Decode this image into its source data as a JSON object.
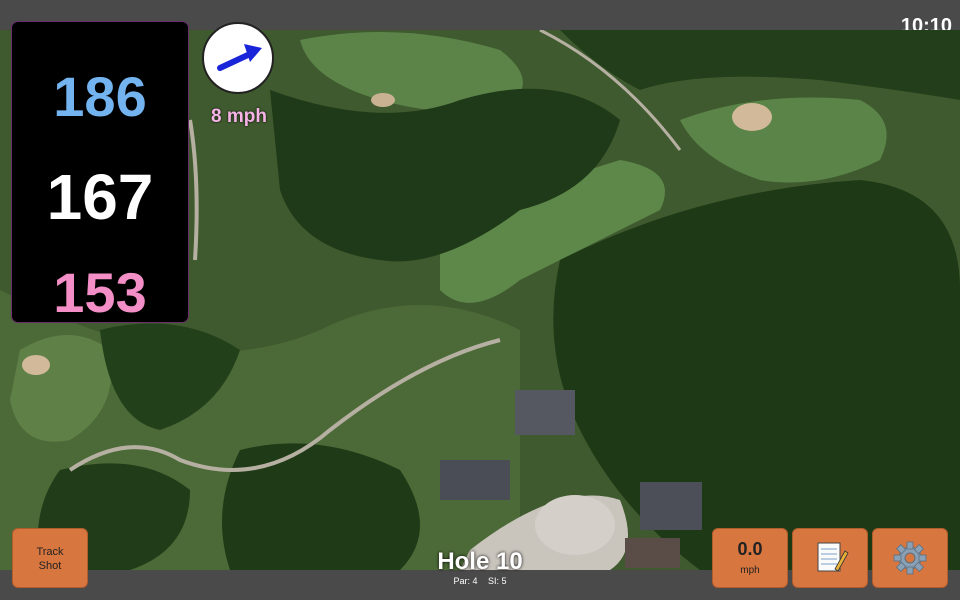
{
  "clock": "10:10",
  "distances": {
    "back": "186",
    "middle": "167",
    "front": "153"
  },
  "wind": {
    "speed_label": "8 mph",
    "direction_icon": "arrow-icon"
  },
  "buttons": {
    "track_shot_line1": "Track",
    "track_shot_line2": "Shot",
    "wind_value": "0.0",
    "wind_unit": "mph",
    "notes_icon": "notepad-icon",
    "settings_icon": "gear-icon"
  },
  "hole": {
    "title": "Hole 10",
    "par": "Par: 4",
    "si": "SI: 5"
  },
  "colors": {
    "back": "#73b4f0",
    "middle": "#ffffff",
    "front": "#f38fc6",
    "button": "#d8763f"
  }
}
